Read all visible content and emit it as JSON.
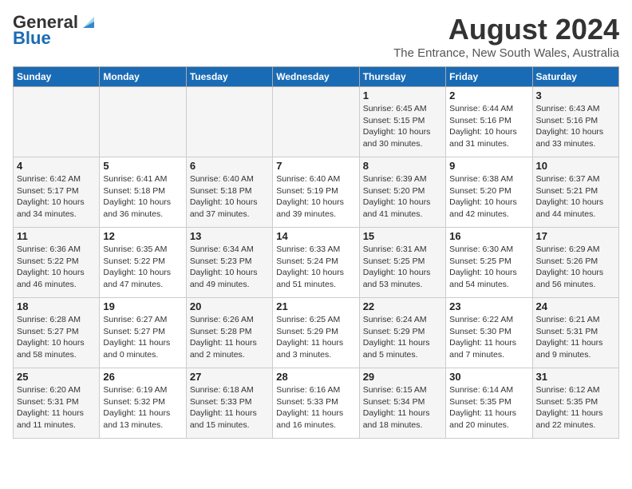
{
  "logo": {
    "general": "General",
    "blue": "Blue"
  },
  "header": {
    "month": "August 2024",
    "location": "The Entrance, New South Wales, Australia"
  },
  "weekdays": [
    "Sunday",
    "Monday",
    "Tuesday",
    "Wednesday",
    "Thursday",
    "Friday",
    "Saturday"
  ],
  "weeks": [
    [
      {
        "day": "",
        "info": ""
      },
      {
        "day": "",
        "info": ""
      },
      {
        "day": "",
        "info": ""
      },
      {
        "day": "",
        "info": ""
      },
      {
        "day": "1",
        "info": "Sunrise: 6:45 AM\nSunset: 5:15 PM\nDaylight: 10 hours\nand 30 minutes."
      },
      {
        "day": "2",
        "info": "Sunrise: 6:44 AM\nSunset: 5:16 PM\nDaylight: 10 hours\nand 31 minutes."
      },
      {
        "day": "3",
        "info": "Sunrise: 6:43 AM\nSunset: 5:16 PM\nDaylight: 10 hours\nand 33 minutes."
      }
    ],
    [
      {
        "day": "4",
        "info": "Sunrise: 6:42 AM\nSunset: 5:17 PM\nDaylight: 10 hours\nand 34 minutes."
      },
      {
        "day": "5",
        "info": "Sunrise: 6:41 AM\nSunset: 5:18 PM\nDaylight: 10 hours\nand 36 minutes."
      },
      {
        "day": "6",
        "info": "Sunrise: 6:40 AM\nSunset: 5:18 PM\nDaylight: 10 hours\nand 37 minutes."
      },
      {
        "day": "7",
        "info": "Sunrise: 6:40 AM\nSunset: 5:19 PM\nDaylight: 10 hours\nand 39 minutes."
      },
      {
        "day": "8",
        "info": "Sunrise: 6:39 AM\nSunset: 5:20 PM\nDaylight: 10 hours\nand 41 minutes."
      },
      {
        "day": "9",
        "info": "Sunrise: 6:38 AM\nSunset: 5:20 PM\nDaylight: 10 hours\nand 42 minutes."
      },
      {
        "day": "10",
        "info": "Sunrise: 6:37 AM\nSunset: 5:21 PM\nDaylight: 10 hours\nand 44 minutes."
      }
    ],
    [
      {
        "day": "11",
        "info": "Sunrise: 6:36 AM\nSunset: 5:22 PM\nDaylight: 10 hours\nand 46 minutes."
      },
      {
        "day": "12",
        "info": "Sunrise: 6:35 AM\nSunset: 5:22 PM\nDaylight: 10 hours\nand 47 minutes."
      },
      {
        "day": "13",
        "info": "Sunrise: 6:34 AM\nSunset: 5:23 PM\nDaylight: 10 hours\nand 49 minutes."
      },
      {
        "day": "14",
        "info": "Sunrise: 6:33 AM\nSunset: 5:24 PM\nDaylight: 10 hours\nand 51 minutes."
      },
      {
        "day": "15",
        "info": "Sunrise: 6:31 AM\nSunset: 5:25 PM\nDaylight: 10 hours\nand 53 minutes."
      },
      {
        "day": "16",
        "info": "Sunrise: 6:30 AM\nSunset: 5:25 PM\nDaylight: 10 hours\nand 54 minutes."
      },
      {
        "day": "17",
        "info": "Sunrise: 6:29 AM\nSunset: 5:26 PM\nDaylight: 10 hours\nand 56 minutes."
      }
    ],
    [
      {
        "day": "18",
        "info": "Sunrise: 6:28 AM\nSunset: 5:27 PM\nDaylight: 10 hours\nand 58 minutes."
      },
      {
        "day": "19",
        "info": "Sunrise: 6:27 AM\nSunset: 5:27 PM\nDaylight: 11 hours\nand 0 minutes."
      },
      {
        "day": "20",
        "info": "Sunrise: 6:26 AM\nSunset: 5:28 PM\nDaylight: 11 hours\nand 2 minutes."
      },
      {
        "day": "21",
        "info": "Sunrise: 6:25 AM\nSunset: 5:29 PM\nDaylight: 11 hours\nand 3 minutes."
      },
      {
        "day": "22",
        "info": "Sunrise: 6:24 AM\nSunset: 5:29 PM\nDaylight: 11 hours\nand 5 minutes."
      },
      {
        "day": "23",
        "info": "Sunrise: 6:22 AM\nSunset: 5:30 PM\nDaylight: 11 hours\nand 7 minutes."
      },
      {
        "day": "24",
        "info": "Sunrise: 6:21 AM\nSunset: 5:31 PM\nDaylight: 11 hours\nand 9 minutes."
      }
    ],
    [
      {
        "day": "25",
        "info": "Sunrise: 6:20 AM\nSunset: 5:31 PM\nDaylight: 11 hours\nand 11 minutes."
      },
      {
        "day": "26",
        "info": "Sunrise: 6:19 AM\nSunset: 5:32 PM\nDaylight: 11 hours\nand 13 minutes."
      },
      {
        "day": "27",
        "info": "Sunrise: 6:18 AM\nSunset: 5:33 PM\nDaylight: 11 hours\nand 15 minutes."
      },
      {
        "day": "28",
        "info": "Sunrise: 6:16 AM\nSunset: 5:33 PM\nDaylight: 11 hours\nand 16 minutes."
      },
      {
        "day": "29",
        "info": "Sunrise: 6:15 AM\nSunset: 5:34 PM\nDaylight: 11 hours\nand 18 minutes."
      },
      {
        "day": "30",
        "info": "Sunrise: 6:14 AM\nSunset: 5:35 PM\nDaylight: 11 hours\nand 20 minutes."
      },
      {
        "day": "31",
        "info": "Sunrise: 6:12 AM\nSunset: 5:35 PM\nDaylight: 11 hours\nand 22 minutes."
      }
    ]
  ]
}
